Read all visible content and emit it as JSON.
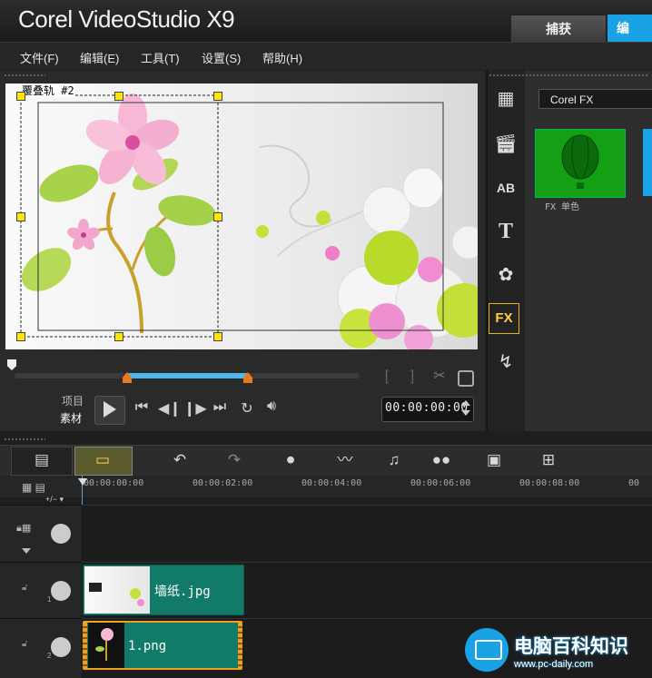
{
  "app": {
    "title": "Corel VideoStudio X9"
  },
  "top_tabs": {
    "capture": "捕获",
    "edit": "编"
  },
  "menu": [
    "文件(F)",
    "编辑(E)",
    "工具(T)",
    "设置(S)",
    "帮助(H)"
  ],
  "preview": {
    "overlay_label": "覆叠轨 #2",
    "mode_project": "项目",
    "mode_clip": "素材",
    "timecode": "00:00:00:00"
  },
  "library": {
    "category": "Corel FX",
    "thumbnails": [
      {
        "label": "FX 单色"
      }
    ],
    "icons": [
      "media-icon",
      "instant-project-icon",
      "transition-icon",
      "title-icon",
      "graphic-icon",
      "filter-icon",
      "path-icon"
    ]
  },
  "timeline": {
    "ruler_labels": [
      "00:00:00:00",
      "00:00:02:00",
      "00:00:04:00",
      "00:00:06:00",
      "00:00:08:00",
      "00"
    ],
    "tracks": [
      {
        "index": "",
        "clips": []
      },
      {
        "index": "1",
        "clips": [
          {
            "label": "墙纸.jpg"
          }
        ]
      },
      {
        "index": "2",
        "clips": [
          {
            "label": "1.png"
          }
        ]
      }
    ]
  },
  "watermark": {
    "title": "电脑百科知识",
    "url": "www.pc-daily.com"
  },
  "colors": {
    "accent": "#19a3e6",
    "clip": "#127a68",
    "handle": "#ffe600",
    "fx_thumb": "#14a014"
  }
}
